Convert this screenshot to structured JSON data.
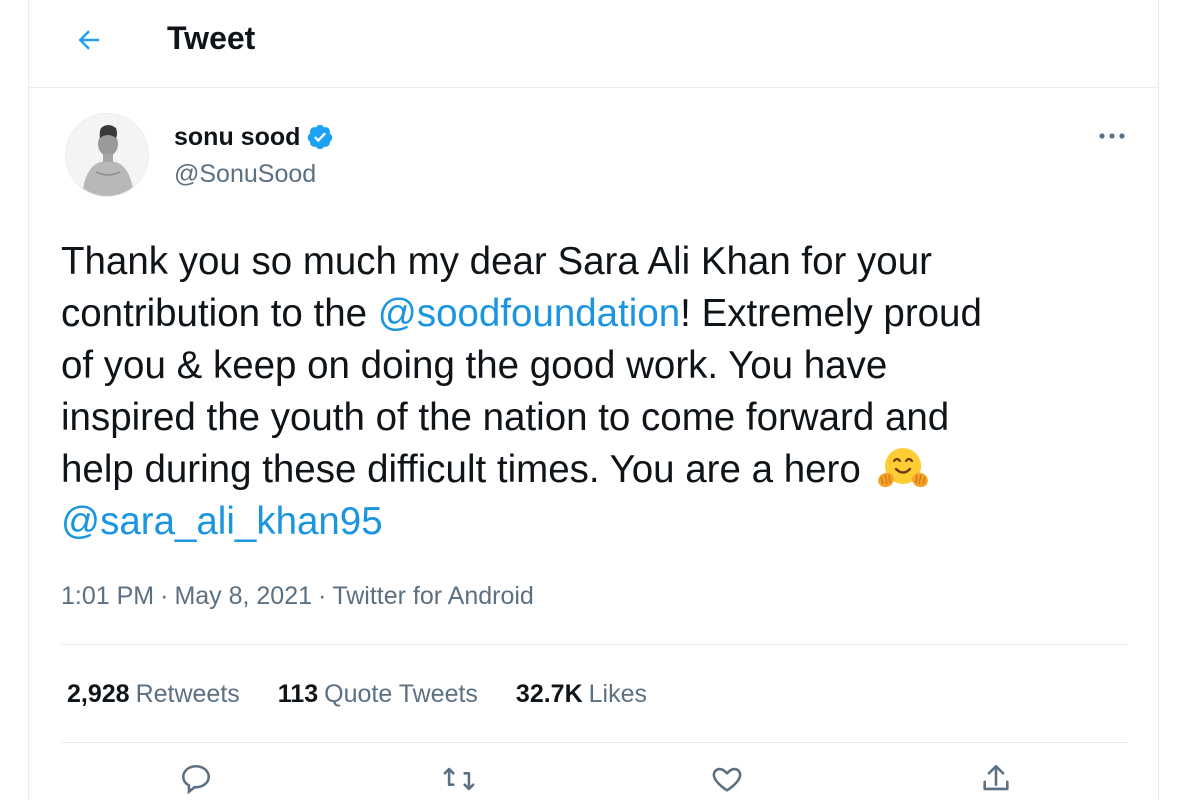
{
  "header": {
    "title": "Tweet",
    "back_icon": "arrow-left-icon"
  },
  "colors": {
    "accent": "#1da1f2",
    "link": "#1b95e0",
    "secondary_text": "#5b7083",
    "border": "#e6ecf0"
  },
  "tweet": {
    "author": {
      "name": "sonu sood",
      "handle": "@SonuSood",
      "verified": true
    },
    "text": {
      "line1": "Thank you so much my dear Sara Ali Khan for your",
      "line2_pre": "contribution to the ",
      "line2_mention": "@soodfoundation",
      "line2_post": "! Extremely proud",
      "line3": "of you & keep on doing the good work. You have",
      "line4": "inspired the youth of the nation to come forward and",
      "line5": "help during these difficult times. You are a hero ",
      "line5_emoji": "hugging-face-emoji",
      "line6_mention": "@sara_ali_khan95"
    },
    "time": "1:01 PM",
    "separator": "·",
    "date": "May 8, 2021",
    "source": "Twitter for Android"
  },
  "stats": [
    {
      "count": "2,928",
      "label": "Retweets"
    },
    {
      "count": "113",
      "label": "Quote Tweets"
    },
    {
      "count": "32.7K",
      "label": "Likes"
    }
  ],
  "actions": [
    {
      "name": "reply",
      "icon": "reply-icon"
    },
    {
      "name": "retweet",
      "icon": "retweet-icon"
    },
    {
      "name": "like",
      "icon": "heart-icon"
    },
    {
      "name": "share",
      "icon": "share-icon"
    }
  ]
}
